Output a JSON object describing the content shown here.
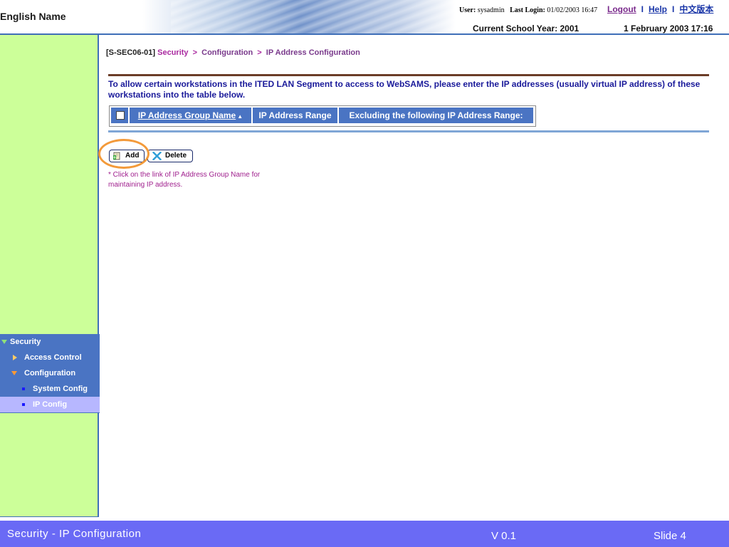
{
  "header": {
    "app_name": "English Name",
    "user_label": "User:",
    "user": "sysadmin",
    "last_login_label": "Last Login:",
    "last_login": "01/02/2003 16:47",
    "logout": "Logout",
    "separator": "I",
    "help": "Help",
    "chinese": "中文版本",
    "school_year": "Current School Year: 2001",
    "date_time": "1 February 2003 17:16"
  },
  "sidebar": {
    "items": [
      {
        "label": "Security"
      },
      {
        "label": "Access Control"
      },
      {
        "label": "Configuration"
      },
      {
        "label": "System Config"
      },
      {
        "label": "IP Config",
        "selected": true
      }
    ]
  },
  "breadcrumb": {
    "code": "[S-SEC06-01]",
    "items": [
      "Security",
      "Configuration",
      "IP Address Configuration"
    ],
    "separator": ">"
  },
  "instruction": "To allow certain workstations in the ITED LAN Segment to access to WebSAMS, please enter the IP addresses (usually virtual IP address) of these workstations into the table below.",
  "table": {
    "columns": [
      "IP Address Group Name",
      "IP Address Range",
      "Excluding the following IP Address Range:"
    ],
    "sort_indicator": "▲",
    "rows": []
  },
  "buttons": {
    "add": "Add",
    "delete": "Delete"
  },
  "note": "* Click on the link of IP Address Group Name for maintaining IP address.",
  "footer": {
    "title": "Security - IP Configuration",
    "version": "V 0.1",
    "slide": "Slide 4"
  },
  "colors": {
    "sidebar_green": "#ccff99",
    "nav_blue": "#4a74c3",
    "selected": "#b7b7ff",
    "footer": "#6a6af5",
    "highlight": "#f39a3a"
  }
}
